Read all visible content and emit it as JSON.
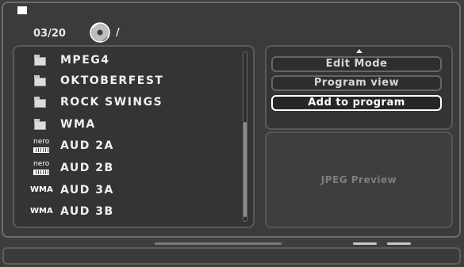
{
  "header": {
    "track_counter": "03/20",
    "path": "/"
  },
  "file_list": {
    "items": [
      {
        "type": "folder",
        "label": "MPEG4",
        "icon": "folder-icon"
      },
      {
        "type": "folder",
        "label": "OKTOBERFEST",
        "icon": "folder-icon"
      },
      {
        "type": "folder",
        "label": "ROCK SWINGS",
        "icon": "folder-icon"
      },
      {
        "type": "folder",
        "label": "WMA",
        "icon": "folder-icon"
      },
      {
        "type": "nero",
        "label": "AUD 2A",
        "icon": "nero-audio-icon",
        "icon_text": "nero"
      },
      {
        "type": "nero",
        "label": "AUD 2B",
        "icon": "nero-audio-icon",
        "icon_text": "nero"
      },
      {
        "type": "wma",
        "label": "AUD 3A",
        "icon": "wma-file-icon",
        "icon_text": "WMA"
      },
      {
        "type": "wma",
        "label": "AUD 3B",
        "icon": "wma-file-icon",
        "icon_text": "WMA"
      }
    ]
  },
  "options": {
    "edit_mode": "Edit Mode",
    "program_view": "Program view",
    "add_to_program": "Add to program"
  },
  "preview": {
    "label": "JPEG Preview"
  },
  "colors": {
    "background": "#3e3e3e",
    "panel": "#343434",
    "text": "#f2f2f2",
    "selected_border": "#ffffff"
  }
}
